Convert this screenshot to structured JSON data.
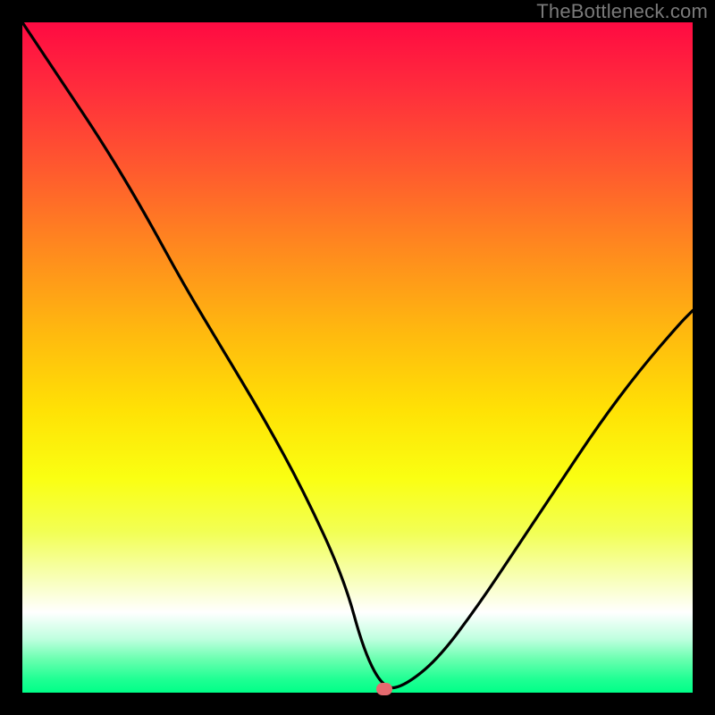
{
  "watermark": "TheBottleneck.com",
  "chart_data": {
    "type": "line",
    "title": "",
    "xlabel": "",
    "ylabel": "",
    "xlim": [
      0,
      100
    ],
    "ylim": [
      0,
      100
    ],
    "grid": false,
    "legend": false,
    "series": [
      {
        "name": "bottleneck-curve",
        "x": [
          0,
          6,
          12,
          18,
          24,
          30,
          36,
          42,
          48,
          51,
          54,
          57,
          62,
          68,
          74,
          80,
          86,
          92,
          98,
          100
        ],
        "y": [
          100,
          91,
          82,
          72,
          61,
          51,
          41,
          30,
          17,
          6,
          0.5,
          1,
          5,
          13,
          22,
          31,
          40,
          48,
          55,
          57
        ]
      }
    ],
    "marker": {
      "x": 54,
      "y": 0.5,
      "color": "#e46a6f"
    },
    "background_gradient": {
      "stops": [
        {
          "pos": 0,
          "color": "#ff0a42"
        },
        {
          "pos": 50,
          "color": "#ffe205"
        },
        {
          "pos": 88,
          "color": "#ffffff"
        },
        {
          "pos": 100,
          "color": "#00ff88"
        }
      ]
    }
  }
}
